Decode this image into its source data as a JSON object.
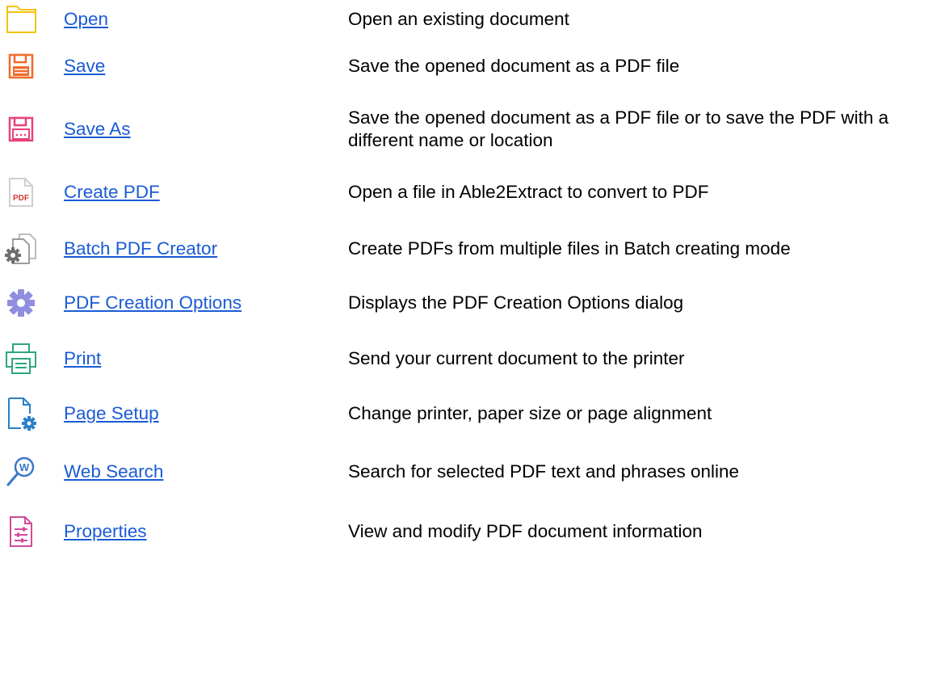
{
  "items": [
    {
      "label": "Open",
      "description": "Open an existing document",
      "icon": "folder-icon",
      "color": "#f1c40f"
    },
    {
      "label": "Save",
      "description": "Save the opened document as a PDF file",
      "icon": "save-icon",
      "color": "#f26b2a"
    },
    {
      "label": "Save As",
      "description": "Save the opened document as a PDF file or to save the PDF with a different name or location",
      "icon": "save-as-icon",
      "color": "#e8417b"
    },
    {
      "label": "Create PDF",
      "description": "Open a file in Able2Extract to convert to PDF",
      "icon": "create-pdf-icon",
      "color": "#d63b30"
    },
    {
      "label": "Batch PDF Creator",
      "description": "Create PDFs from multiple files in Batch creating mode",
      "icon": "batch-pdf-creator-icon",
      "color": "#6e6e6e"
    },
    {
      "label": "PDF Creation Options",
      "description": "Displays the PDF Creation Options dialog",
      "icon": "gear-icon",
      "color": "#8f8ee0"
    },
    {
      "label": "Print",
      "description": "Send your current document to the printer",
      "icon": "printer-icon",
      "color": "#2fa67a"
    },
    {
      "label": "Page Setup",
      "description": "Change printer, paper size or page alignment",
      "icon": "page-setup-icon",
      "color": "#2a7fc9"
    },
    {
      "label": "Web Search",
      "description": "Search for selected PDF text and phrases online",
      "icon": "web-search-icon",
      "color": "#3a78c8"
    },
    {
      "label": "Properties",
      "description": "View and modify PDF document information",
      "icon": "properties-icon",
      "color": "#d04a9c"
    }
  ]
}
